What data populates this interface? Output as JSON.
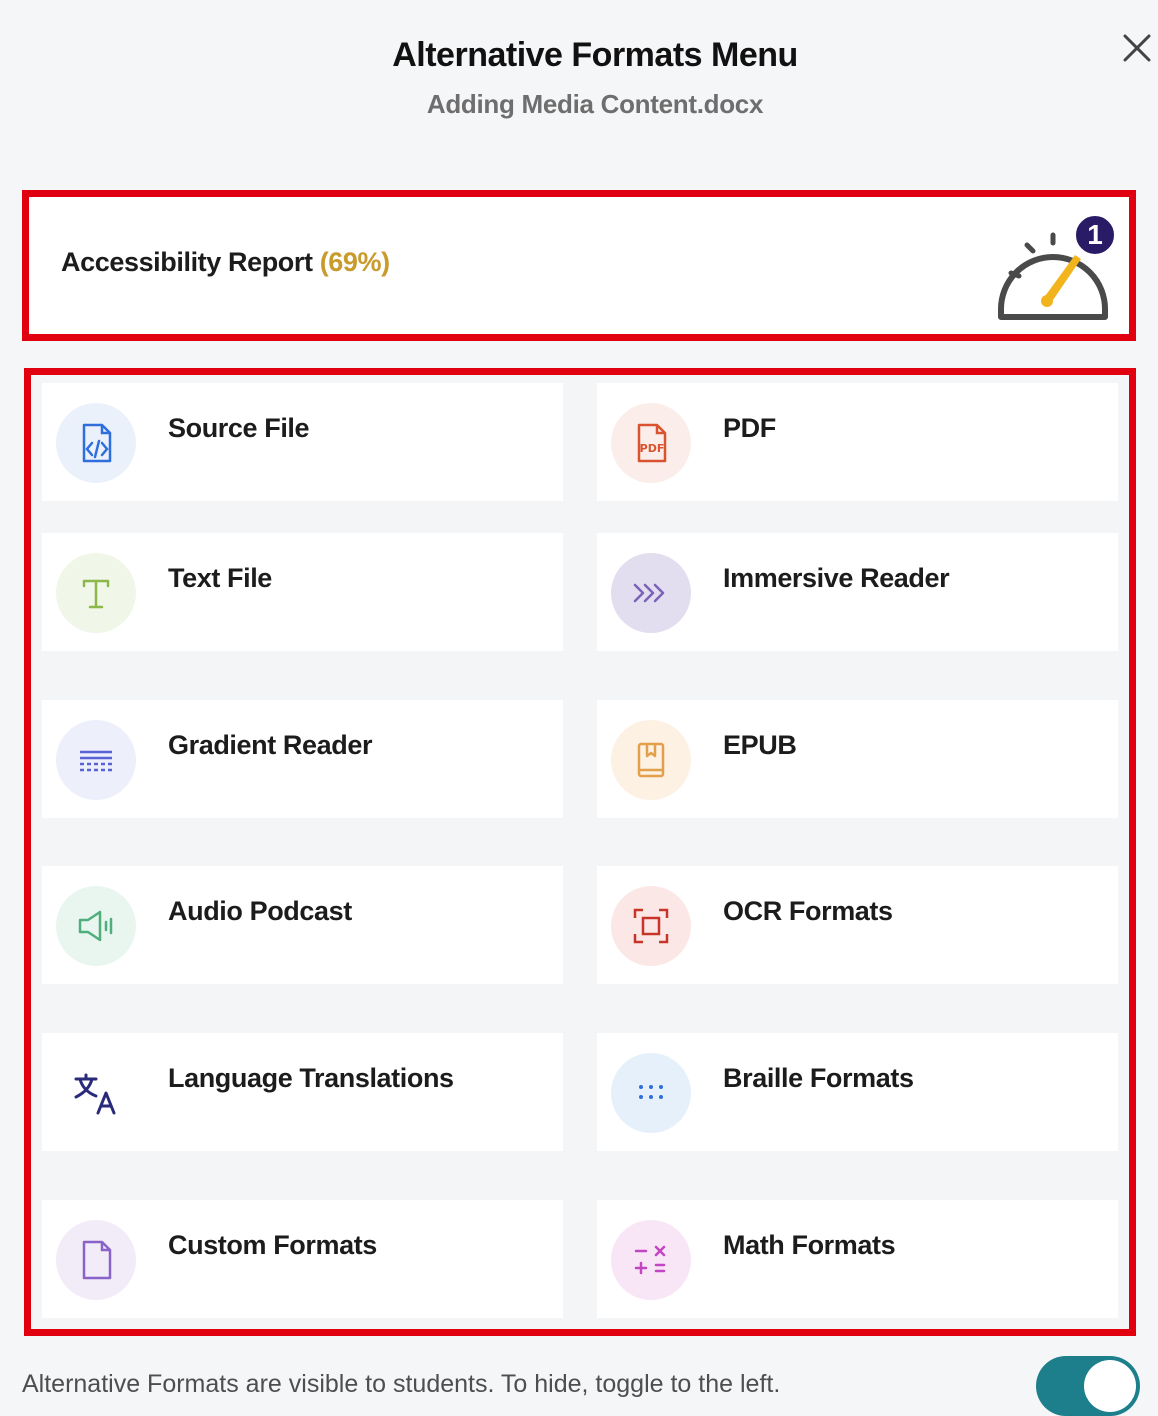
{
  "header": {
    "title": "Alternative Formats Menu",
    "subtitle": "Adding Media Content.docx",
    "close_icon": "close-icon"
  },
  "report": {
    "label": "Accessibility Report",
    "percentage_text": "(69%)",
    "score_percent": 69,
    "badge_count": "1",
    "icon": "gauge-icon",
    "colors": {
      "pct": "#c99a2c",
      "needle": "#f2b41c",
      "badge": "#2a1b66"
    }
  },
  "formats": [
    {
      "label": "Source File",
      "icon": "code-file-icon",
      "tint": "#eaf1fb",
      "color": "#2f6fdc"
    },
    {
      "label": "PDF",
      "icon": "pdf-icon",
      "tint": "#fbeeea",
      "color": "#d9532e"
    },
    {
      "label": "Text File",
      "icon": "text-t-icon",
      "tint": "#f0f6e8",
      "color": "#8cb84a"
    },
    {
      "label": "Immersive Reader",
      "icon": "immersive-reader-icon",
      "tint": "#e3ddf0",
      "color": "#7a63b8"
    },
    {
      "label": "Gradient Reader",
      "icon": "gradient-lines-icon",
      "tint": "#edf0fb",
      "color": "#5a63d6"
    },
    {
      "label": "EPUB",
      "icon": "book-icon",
      "tint": "#fdf1e4",
      "color": "#e3a04a"
    },
    {
      "label": "Audio Podcast",
      "icon": "speaker-icon",
      "tint": "#e8f6ef",
      "color": "#4fae7c"
    },
    {
      "label": "OCR Formats",
      "icon": "scan-icon",
      "tint": "#fbe8e6",
      "color": "#c7352a"
    },
    {
      "label": "Language Translations",
      "icon": "translate-icon",
      "tint": "#ffffff",
      "color": "#2a2a7a"
    },
    {
      "label": "Braille Formats",
      "icon": "braille-icon",
      "tint": "#e6f0fb",
      "color": "#2f6fdc"
    },
    {
      "label": "Custom Formats",
      "icon": "blank-file-icon",
      "tint": "#f1ecf8",
      "color": "#8a63c8"
    },
    {
      "label": "Math Formats",
      "icon": "math-icon",
      "tint": "#f8e6f6",
      "color": "#c245c2"
    }
  ],
  "footer": {
    "text": "Alternative Formats are visible to students. To hide, toggle to the left.",
    "toggle_on": true,
    "toggle_color": "#1e7f8c"
  }
}
